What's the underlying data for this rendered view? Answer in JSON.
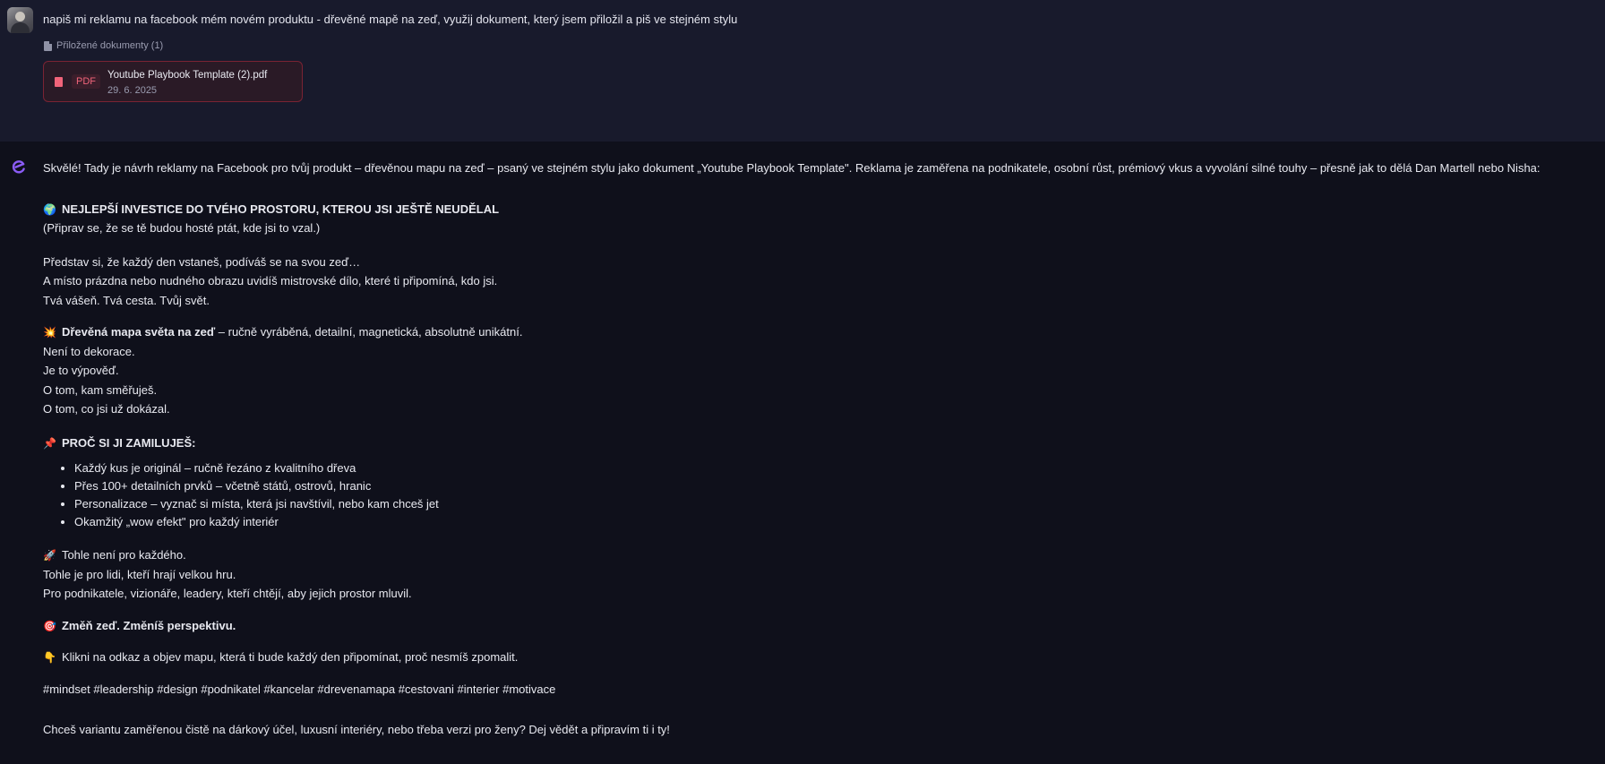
{
  "user_message": {
    "prompt": "napiš mi reklamu na facebook mém novém produktu - dřevěné mapě na zeď, využij dokument, který jsem přiložil a piš ve stejném stylu",
    "attachments_label": "Přiložené dokumenty (1)",
    "attachment": {
      "type_badge": "PDF",
      "file_name": "Youtube Playbook Template (2).pdf",
      "date": "29. 6. 2025"
    }
  },
  "assistant_message": {
    "intro": "Skvělé! Tady je návrh reklamy na Facebook pro tvůj produkt – dřevěnou mapu na zeď – psaný ve stejném stylu jako dokument „Youtube Playbook Template\". Reklama je zaměřena na podnikatele, osobní růst, prémiový vkus a vyvolání silné touhy – přesně jak to dělá Dan Martell nebo Nisha:",
    "headline_emoji": "🌍",
    "headline": "NEJLEPŠÍ INVESTICE DO TVÉHO PROSTORU, KTEROU JSI JEŠTĚ NEUDĚLAL",
    "subheadline": "(Připrav se, že se tě budou hosté ptát, kde jsi to vzal.)",
    "imagine_lines": [
      "Představ si, že každý den vstaneš, podíváš se na svou zeď…",
      "A místo prázdna nebo nudného obrazu uvidíš mistrovské dílo, které ti připomíná, kdo jsi.",
      "Tvá vášeň. Tvá cesta. Tvůj svět."
    ],
    "product_emoji": "💥",
    "product_bold": "Dřevěná mapa světa na zeď",
    "product_rest": " – ručně vyráběná, detailní, magnetická, absolutně unikátní.",
    "statement_lines": [
      "Není to dekorace.",
      "Je to výpověď.",
      "O tom, kam směřuješ.",
      "O tom, co jsi už dokázal."
    ],
    "why_emoji": "📌",
    "why_heading": "PROČ SI JI ZAMILUJEŠ:",
    "why_bullets": [
      "Každý kus je originál – ručně řezáno z kvalitního dřeva",
      "Přes 100+ detailních prvků – včetně států, ostrovů, hranic",
      "Personalizace – vyznač si místa, která jsi navštívil, nebo kam chceš jet",
      "Okamžitý „wow efekt\" pro každý interiér"
    ],
    "audience_emoji": "🚀",
    "audience_lines": [
      "Tohle není pro každého.",
      "Tohle je pro lidi, kteří hrají velkou hru.",
      "Pro podnikatele, vizionáře, leadery, kteří chtějí, aby jejich prostor mluvil."
    ],
    "tagline_emoji": "🎯",
    "tagline": "Změň zeď. Změníš perspektivu.",
    "cta_emoji": "👇",
    "cta": "Klikni na odkaz a objev mapu, která ti bude každý den připomínat, proč nesmíš zpomalit.",
    "hashtags": "#mindset #leadership #design #podnikatel #kancelar #drevenamapa #cestovani #interier #motivace",
    "closing": "Chceš variantu zaměřenou čistě na dárkový účel, luxusní interiéry, nebo třeba verzi pro ženy? Dej vědět a připravím ti i ty!"
  },
  "colors": {
    "user_background": "#181a2c",
    "page_background": "#0f101b",
    "pdf_accent": "#f0647a",
    "assistant_icon": "#8b5cf6"
  }
}
